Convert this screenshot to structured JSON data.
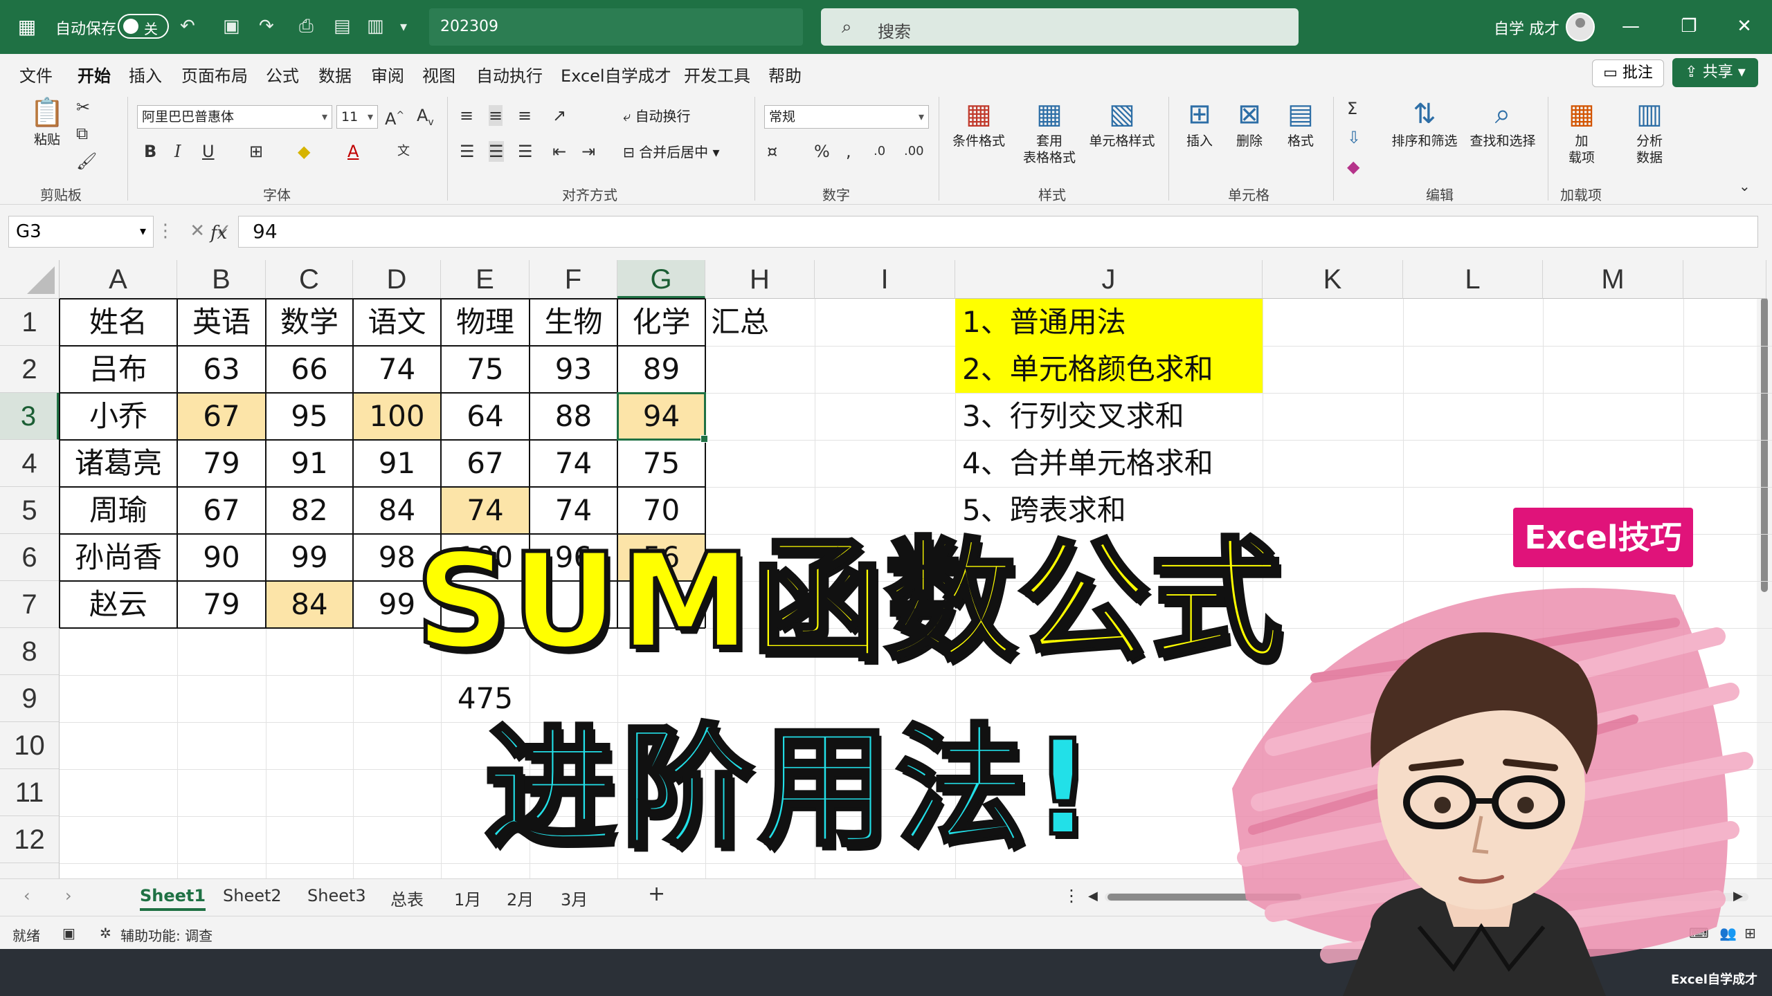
{
  "titlebar": {
    "autosave_label": "自动保存",
    "autosave_state": "关",
    "filename": "202309",
    "search_placeholder": "搜索",
    "user": "自学 成才"
  },
  "menu": {
    "tabs": [
      "文件",
      "开始",
      "插入",
      "页面布局",
      "公式",
      "数据",
      "审阅",
      "视图",
      "自动执行",
      "Excel自学成才",
      "开发工具",
      "帮助"
    ],
    "active": "开始",
    "comment_label": "批注",
    "share_label": "共享"
  },
  "ribbon": {
    "clipboard": {
      "paste": "粘贴",
      "group": "剪贴板"
    },
    "font": {
      "name": "阿里巴巴普惠体",
      "size": "11",
      "group": "字体"
    },
    "alignment": {
      "wrap": "自动换行",
      "merge": "合并后居中",
      "group": "对齐方式"
    },
    "number": {
      "format": "常规",
      "group": "数字"
    },
    "styles": {
      "conditional": "条件格式",
      "table_format_1": "套用",
      "table_format_2": "表格格式",
      "cell_styles": "单元格样式",
      "group": "样式"
    },
    "cells": {
      "insert": "插入",
      "delete": "删除",
      "format": "格式",
      "group": "单元格"
    },
    "editing": {
      "sort_filter": "排序和筛选",
      "find_select": "查找和选择",
      "group": "编辑"
    },
    "addins": {
      "addin_1": "加",
      "addin_2": "载项",
      "analyze_1": "分析",
      "analyze_2": "数据",
      "group": "加载项"
    }
  },
  "formula_bar": {
    "name_box": "G3",
    "fx": "fx",
    "value": "94"
  },
  "grid": {
    "columns": [
      "A",
      "B",
      "C",
      "D",
      "E",
      "F",
      "G",
      "H",
      "I",
      "J",
      "K",
      "L",
      "M"
    ],
    "rows": [
      "1",
      "2",
      "3",
      "4",
      "5",
      "6",
      "7",
      "8",
      "9",
      "10",
      "11",
      "12"
    ],
    "selected_cell": "G3",
    "headers": [
      "姓名",
      "英语",
      "数学",
      "语文",
      "物理",
      "生物",
      "化学"
    ],
    "summary_label": "汇总",
    "records": [
      {
        "name": "吕布",
        "scores": [
          "63",
          "66",
          "74",
          "75",
          "93",
          "89"
        ]
      },
      {
        "name": "小乔",
        "scores": [
          "67",
          "95",
          "100",
          "64",
          "88",
          "94"
        ]
      },
      {
        "name": "诸葛亮",
        "scores": [
          "79",
          "91",
          "91",
          "67",
          "74",
          "75"
        ]
      },
      {
        "name": "周瑜",
        "scores": [
          "67",
          "82",
          "84",
          "74",
          "74",
          "70"
        ]
      },
      {
        "name": "孙尚香",
        "scores": [
          "90",
          "99",
          "98",
          "100",
          "96",
          "56"
        ]
      },
      {
        "name": "赵云",
        "scores": [
          "79",
          "84",
          "99",
          "",
          "",
          ""
        ]
      }
    ],
    "e9_value": "475",
    "notes": [
      "1、普通用法",
      "2、单元格颜色求和",
      "3、行列交叉求和",
      "4、合并单元格求和",
      "5、跨表求和"
    ],
    "highlight_color": "#fce4a8",
    "note_highlight_color": "#ffff00"
  },
  "sheets": {
    "tabs": [
      "Sheet1",
      "Sheet2",
      "Sheet3",
      "总表",
      "1月",
      "2月",
      "3月"
    ],
    "active": "Sheet1",
    "add_label": "+"
  },
  "status": {
    "ready": "就绪",
    "accessibility": "辅助功能: 调查"
  },
  "overlay": {
    "headline": "SUM函数公式",
    "subline": "进阶用法!",
    "badge": "Excel技巧",
    "watermark": "Excel自学成才",
    "headline_color": "#ffff00",
    "subline_color": "#22e0e8",
    "badge_color": "#e0137a"
  },
  "icons": [
    "excel-logo-icon",
    "undo-icon",
    "redo-icon",
    "save-icon",
    "search-icon",
    "minimize-icon",
    "restore-icon",
    "close-icon",
    "paste-icon",
    "cut-icon",
    "copy-icon",
    "format-painter-icon",
    "bold-icon",
    "italic-icon",
    "underline-icon",
    "sum-icon",
    "sort-filter-icon",
    "find-icon"
  ]
}
